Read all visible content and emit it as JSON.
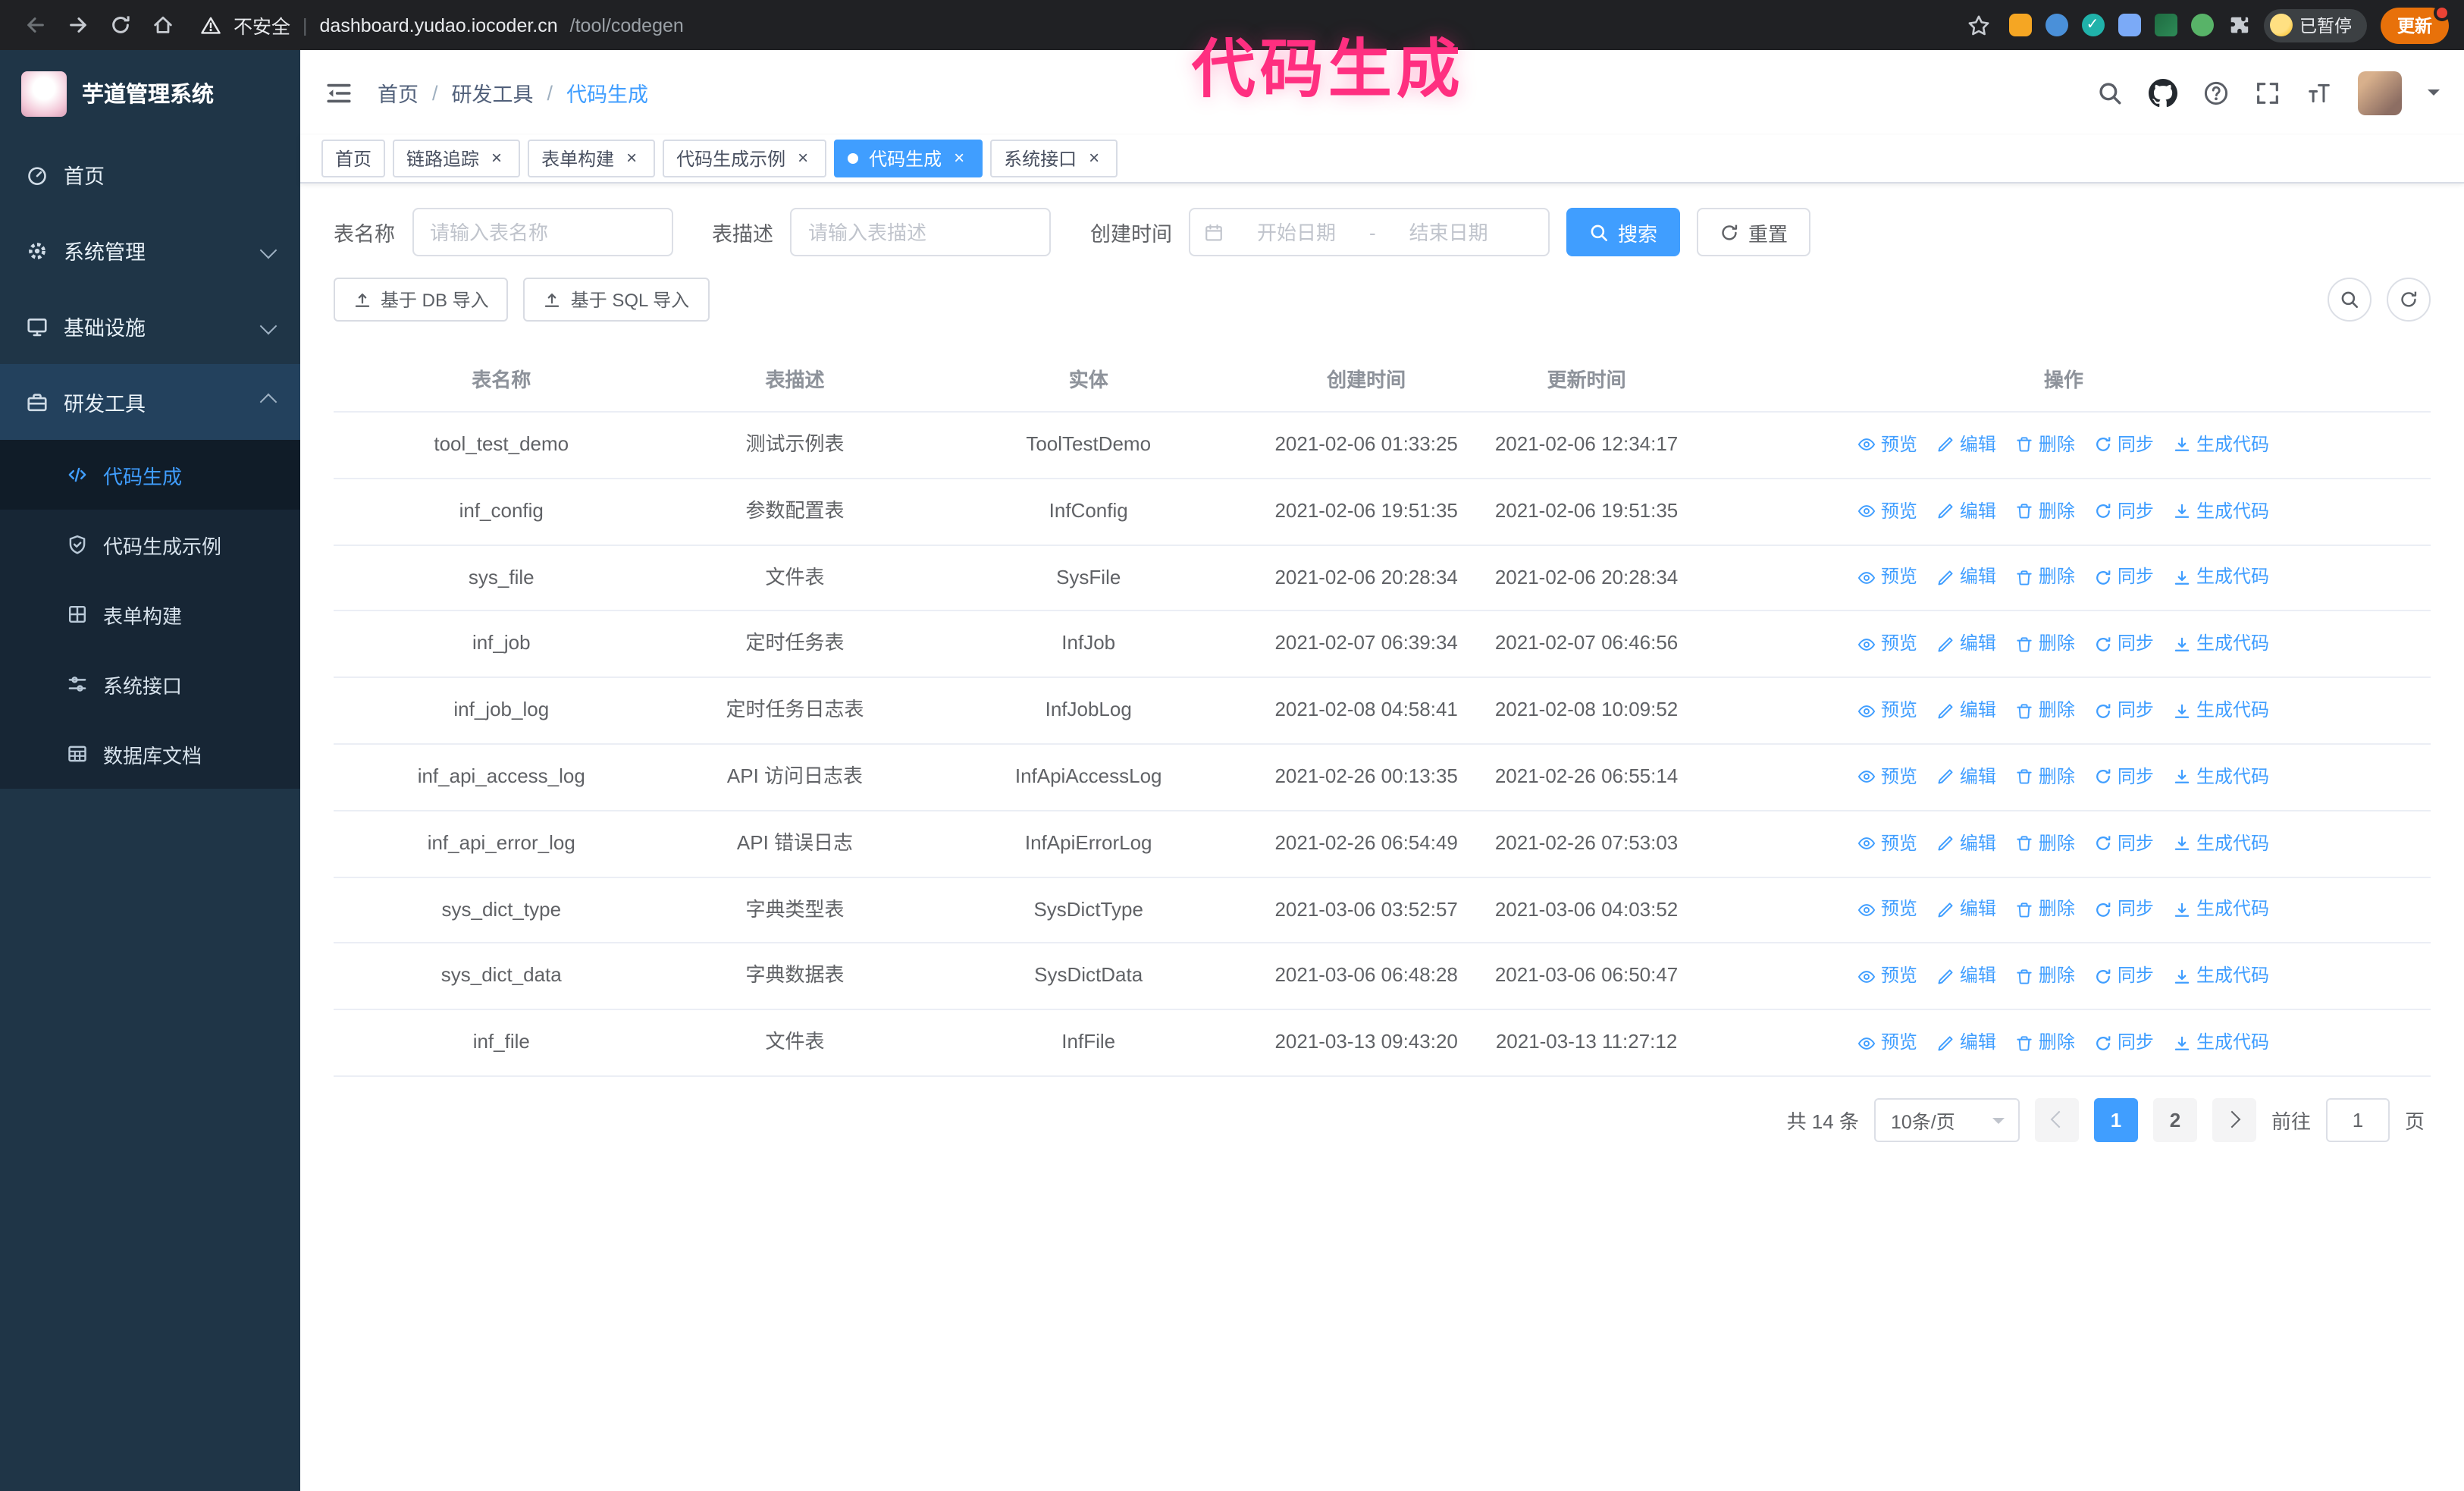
{
  "annotation": {
    "text": "代码生成"
  },
  "browser": {
    "security_label": "不安全",
    "url_host": "dashboard.yudao.iocoder.cn",
    "url_path": "/tool/codegen",
    "profile_badge": "已暂停",
    "update_button": "更新"
  },
  "sidebar": {
    "logo_title": "芋道管理系统",
    "menu": [
      {
        "label": "首页"
      },
      {
        "label": "系统管理"
      },
      {
        "label": "基础设施"
      },
      {
        "label": "研发工具"
      }
    ],
    "submenu": [
      {
        "label": "代码生成"
      },
      {
        "label": "代码生成示例"
      },
      {
        "label": "表单构建"
      },
      {
        "label": "系统接口"
      },
      {
        "label": "数据库文档"
      }
    ]
  },
  "header": {
    "breadcrumb": [
      "首页",
      "研发工具",
      "代码生成"
    ],
    "breadcrumb_separator": "/"
  },
  "tabs": [
    {
      "label": "首页"
    },
    {
      "label": "链路追踪"
    },
    {
      "label": "表单构建"
    },
    {
      "label": "代码生成示例"
    },
    {
      "label": "代码生成"
    },
    {
      "label": "系统接口"
    }
  ],
  "filters": {
    "table_name_label": "表名称",
    "table_name_placeholder": "请输入表名称",
    "table_desc_label": "表描述",
    "table_desc_placeholder": "请输入表描述",
    "create_time_label": "创建时间",
    "date_start_placeholder": "开始日期",
    "date_separator": "-",
    "date_end_placeholder": "结束日期",
    "search_button": "搜索",
    "reset_button": "重置"
  },
  "toolbar": {
    "import_db": "基于 DB 导入",
    "import_sql": "基于 SQL 导入"
  },
  "table": {
    "columns": [
      "表名称",
      "表描述",
      "实体",
      "创建时间",
      "更新时间",
      "操作"
    ],
    "actions": [
      "预览",
      "编辑",
      "删除",
      "同步",
      "生成代码"
    ],
    "rows": [
      {
        "name": "tool_test_demo",
        "desc": "测试示例表",
        "entity": "ToolTestDemo",
        "created": "2021-02-06 01:33:25",
        "updated": "2021-02-06 12:34:17"
      },
      {
        "name": "inf_config",
        "desc": "参数配置表",
        "entity": "InfConfig",
        "created": "2021-02-06 19:51:35",
        "updated": "2021-02-06 19:51:35"
      },
      {
        "name": "sys_file",
        "desc": "文件表",
        "entity": "SysFile",
        "created": "2021-02-06 20:28:34",
        "updated": "2021-02-06 20:28:34"
      },
      {
        "name": "inf_job",
        "desc": "定时任务表",
        "entity": "InfJob",
        "created": "2021-02-07 06:39:34",
        "updated": "2021-02-07 06:46:56"
      },
      {
        "name": "inf_job_log",
        "desc": "定时任务日志表",
        "entity": "InfJobLog",
        "created": "2021-02-08 04:58:41",
        "updated": "2021-02-08 10:09:52"
      },
      {
        "name": "inf_api_access_log",
        "desc": "API 访问日志表",
        "entity": "InfApiAccessLog",
        "created": "2021-02-26 00:13:35",
        "updated": "2021-02-26 06:55:14"
      },
      {
        "name": "inf_api_error_log",
        "desc": "API 错误日志",
        "entity": "InfApiErrorLog",
        "created": "2021-02-26 06:54:49",
        "updated": "2021-02-26 07:53:03"
      },
      {
        "name": "sys_dict_type",
        "desc": "字典类型表",
        "entity": "SysDictType",
        "created": "2021-03-06 03:52:57",
        "updated": "2021-03-06 04:03:52"
      },
      {
        "name": "sys_dict_data",
        "desc": "字典数据表",
        "entity": "SysDictData",
        "created": "2021-03-06 06:48:28",
        "updated": "2021-03-06 06:50:47"
      },
      {
        "name": "inf_file",
        "desc": "文件表",
        "entity": "InfFile",
        "created": "2021-03-13 09:43:20",
        "updated": "2021-03-13 11:27:12"
      }
    ]
  },
  "pagination": {
    "total": "共 14 条",
    "page_size": "10条/页",
    "page1": "1",
    "page2": "2",
    "goto_label": "前往",
    "goto_value": "1",
    "goto_suffix": "页"
  },
  "icons": {
    "close": "×",
    "check": "✓"
  },
  "colors": {
    "accent": "#409eff",
    "annotation": "#ff2f80",
    "sidebar": "#1f3547",
    "update": "#e8710a"
  }
}
